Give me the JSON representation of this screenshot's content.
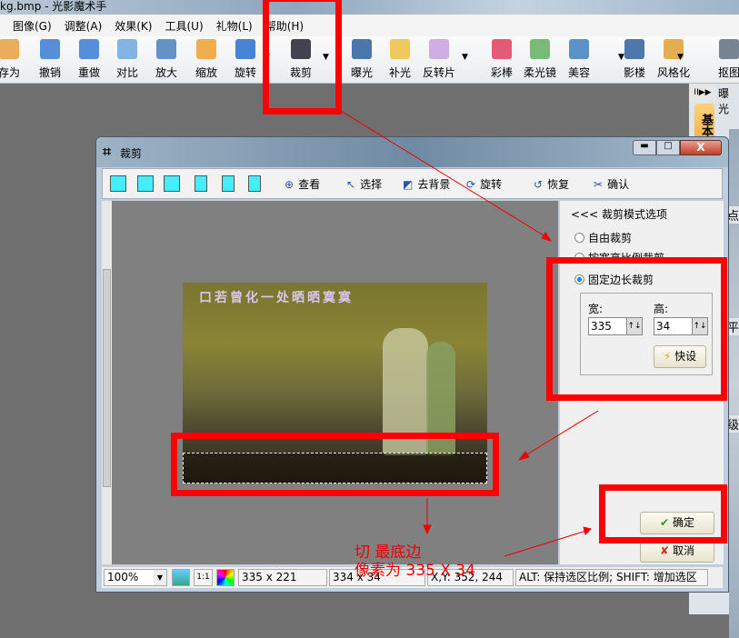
{
  "window": {
    "title": "kg.bmp - 光影魔术手"
  },
  "menu": [
    "图像(G)",
    "调整(A)",
    "效果(K)",
    "工具(U)",
    "礼物(L)",
    "帮助(H)"
  ],
  "toolbar": [
    {
      "label": "存为",
      "icon": "save-icon",
      "color": "#e8a040"
    },
    {
      "label": "撤销",
      "icon": "undo-icon",
      "color": "#3a7bd5"
    },
    {
      "label": "重做",
      "icon": "redo-icon",
      "color": "#3a7bd5"
    },
    {
      "label": "对比",
      "icon": "compare-icon",
      "color": "#6aa8e0"
    },
    {
      "label": "放大",
      "icon": "zoom-in-icon",
      "color": "#4a7fc0"
    },
    {
      "label": "缩放",
      "icon": "resize-icon",
      "color": "#f0a030"
    },
    {
      "label": "旋转",
      "icon": "rotate-icon",
      "color": "#2a6fd0"
    },
    {
      "label": "裁剪",
      "icon": "crop-icon",
      "color": "#223"
    },
    {
      "label": "曝光",
      "icon": "exposure-icon",
      "color": "#2a5fa0"
    },
    {
      "label": "补光",
      "icon": "fill-light-icon",
      "color": "#f0c040"
    },
    {
      "label": "反转片",
      "icon": "reversal-film-icon",
      "color": "#c9a0e0"
    },
    {
      "label": "彩棒",
      "icon": "color-wand-icon",
      "color": "#e04060"
    },
    {
      "label": "柔光镜",
      "icon": "soft-light-icon",
      "color": "#60b060"
    },
    {
      "label": "美容",
      "icon": "beauty-icon",
      "color": "#4080c0"
    },
    {
      "label": "影楼",
      "icon": "studio-icon",
      "color": "#3060a0"
    },
    {
      "label": "风格化",
      "icon": "stylize-icon",
      "color": "#e0a030"
    },
    {
      "label": "抠图",
      "icon": "cutout-icon",
      "color": "#607080"
    }
  ],
  "right_panel": {
    "header": "曝光",
    "tab": "基本调",
    "labels": [
      "点",
      "平",
      "级"
    ]
  },
  "dialog": {
    "title": "裁剪",
    "tools": [
      {
        "label": "查看",
        "icon": "zoom-icon"
      },
      {
        "label": "选择",
        "icon": "pointer-icon"
      },
      {
        "label": "去背景",
        "icon": "remove-bg-icon"
      },
      {
        "label": "旋转",
        "icon": "rotate-icon"
      },
      {
        "label": "恢复",
        "icon": "restore-icon"
      },
      {
        "label": "确认",
        "icon": "scissors-icon"
      }
    ],
    "options_header": "<<< 裁剪模式选项",
    "modes": [
      {
        "label": "自由裁剪",
        "selected": false
      },
      {
        "label": "按宽高比例裁剪",
        "selected": false
      },
      {
        "label": "固定边长裁剪",
        "selected": true
      }
    ],
    "width_label": "宽:",
    "width_value": "335",
    "height_label": "高:",
    "height_value": "34",
    "preset_label": "快设",
    "ok_label": "确定",
    "cancel_label": "取消",
    "photo_caption": "口若曾化一处晒晒寞寞",
    "status": {
      "zoom": "100%",
      "actual_size": "1:1",
      "image_size": "335 x 221",
      "selection_size": "334 x 34",
      "coords": "X,Y: 352, 244",
      "hint": "ALT: 保持选区比例;  SHIFT: 增加选区"
    }
  },
  "annotation": {
    "line1": "切  最底边",
    "line2": "像素为  335  X  34"
  }
}
